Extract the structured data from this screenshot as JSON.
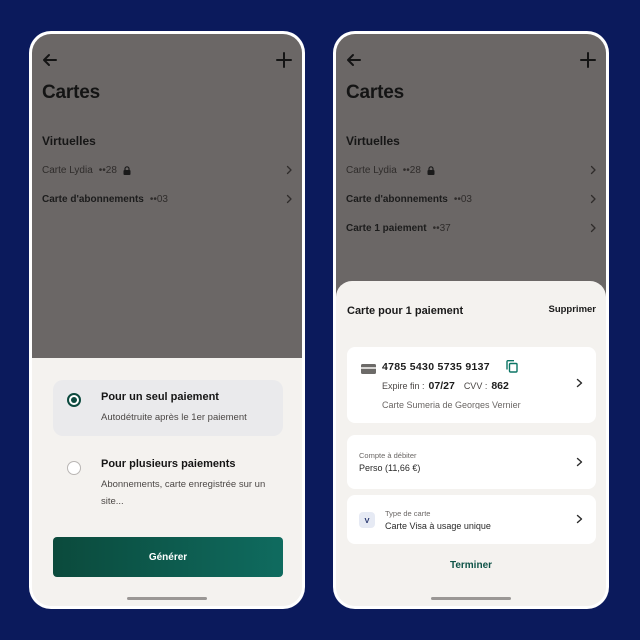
{
  "colors": {
    "background": "#0b1a5c",
    "overlay": "#6b6766",
    "sheet": "#f4f2ef",
    "accent": "#0d4a3f",
    "accent_gradient_end": "#0f6b5f",
    "copy_icon": "#0c7565"
  },
  "icons": {
    "back": "arrow-left-icon",
    "add": "plus-icon",
    "lock": "lock-icon",
    "chevron": "chevron-right-icon",
    "copy": "copy-icon",
    "card": "credit-card-icon"
  },
  "left": {
    "title": "Cartes",
    "section": "Virtuelles",
    "cards": [
      {
        "name": "Carte Lydia",
        "digits": "••28",
        "locked": true
      },
      {
        "name": "Carte d'abonnements",
        "digits": "••03",
        "locked": false
      }
    ],
    "options": [
      {
        "title": "Pour un seul paiement",
        "subtitle": "Autodétruite après le 1er paiement",
        "selected": true
      },
      {
        "title": "Pour plusieurs paiements",
        "subtitle": "Abonnements, carte enregistrée sur un site...",
        "selected": false
      }
    ],
    "generate_label": "Générer"
  },
  "right": {
    "title": "Cartes",
    "section": "Virtuelles",
    "cards": [
      {
        "name": "Carte Lydia",
        "digits": "••28",
        "locked": true
      },
      {
        "name": "Carte d'abonnements",
        "digits": "••03",
        "locked": false
      },
      {
        "name": "Carte 1 paiement",
        "digits": "••37",
        "locked": false
      }
    ],
    "sheet": {
      "title": "Carte pour 1 paiement",
      "delete_label": "Supprimer",
      "card_number": "4785 5430 5735 9137",
      "expiry_label": "Expire fin :",
      "expiry_value": "07/27",
      "cvv_label": "CVV :",
      "cvv_value": "862",
      "holder": "Carte Sumeria de Georges Vernier",
      "account_label": "Compte à débiter",
      "account_value": "Perso (11,66 €)",
      "type_label": "Type de carte",
      "type_value": "Carte Visa à usage unique",
      "type_badge": "V",
      "finish_label": "Terminer"
    }
  }
}
